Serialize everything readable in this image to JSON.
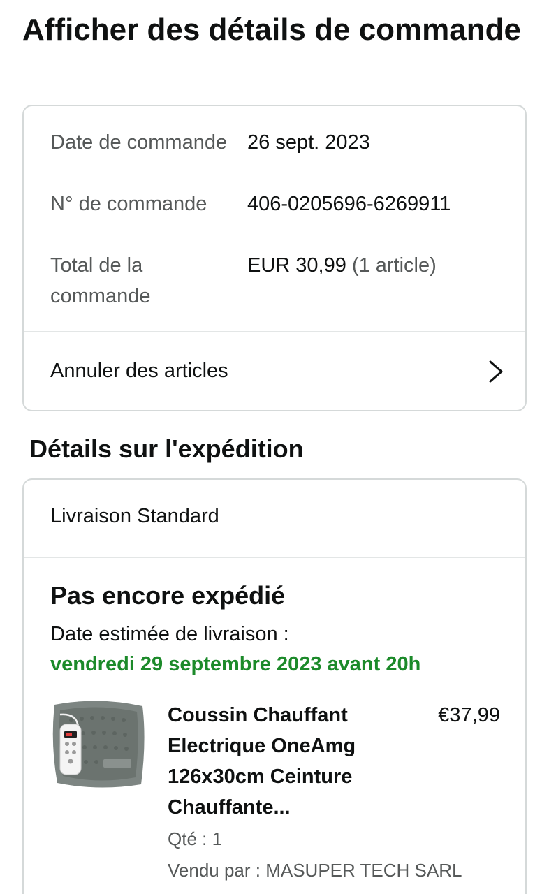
{
  "page": {
    "title": "Afficher des détails de commande"
  },
  "order_summary": {
    "date_label": "Date de commande",
    "date_value": "26 sept. 2023",
    "number_label": "N° de commande",
    "number_value": "406-0205696-6269911",
    "total_label": "Total de la commande",
    "total_value": "EUR 30,99",
    "total_items": "(1 article)",
    "cancel_label": "Annuler des articles"
  },
  "shipping": {
    "section_title": "Détails sur l'expédition",
    "method": "Livraison Standard",
    "status": "Pas encore expédié",
    "eta_label": "Date estimée de livraison :",
    "eta_date": "vendredi 29 septembre 2023 avant 20h",
    "eta_color": "#1c8a2a"
  },
  "product": {
    "title": "Coussin Chauffant Electrique OneAmg 126x30cm Ceinture Chauffante...",
    "price": "€37,99",
    "quantity": "Qté : 1",
    "seller": "Vendu par : MASUPER TECH SARL",
    "image_icon": "heating-pad-image"
  }
}
